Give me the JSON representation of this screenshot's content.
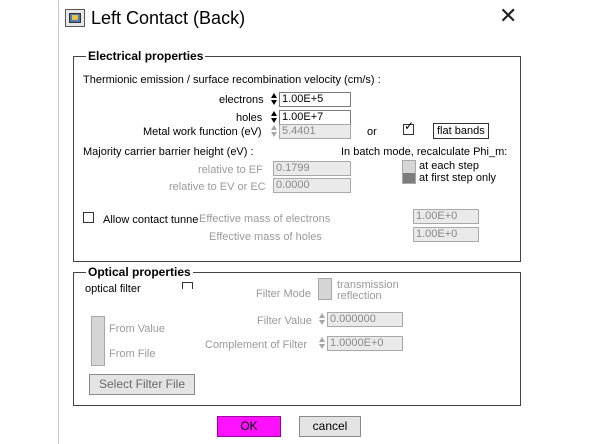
{
  "window": {
    "title": "Left Contact (Back)",
    "close_glyph": "✕"
  },
  "electrical": {
    "legend": "Electrical properties",
    "thermionic_label": "Thermionic emission / surface recombination velocity (cm/s) :",
    "electrons_label": "electrons",
    "electrons_value": "1.00E+5",
    "holes_label": "holes",
    "holes_value": "1.00E+7",
    "work_function_label": "Metal work function (eV)",
    "work_function_value": "5.4401",
    "or_label": "or",
    "flat_bands_checked": true,
    "flat_bands_label": "flat bands",
    "barrier_label": "Majority carrier barrier height (eV) :",
    "batch_label": "In batch mode, recalculate Phi_m:",
    "relative_ef_label": "relative to EF",
    "relative_ef_value": "0.1799",
    "relative_ev_label": "relative to EV or EC",
    "relative_ev_value": "0.0000",
    "batch_option_1": "at each step",
    "batch_option_2": "at first step only",
    "tunnel_label": "Allow contact tunne",
    "tunnel_checked": false,
    "mass_electrons_label": "Effective mass of electrons",
    "mass_electrons_value": "1.00E+0",
    "mass_holes_label": "Effective mass of holes",
    "mass_holes_value": "1.00E+0"
  },
  "optical": {
    "legend": "Optical properties",
    "filter_label": "optical filter",
    "filter_checked": false,
    "filter_mode_label": "Filter Mode",
    "mode_transmission": "transmission",
    "mode_reflection": "reflection",
    "from_value_label": "From Value",
    "from_file_label": "From File",
    "filter_value_label": "Filter Value",
    "filter_value": "0.000000",
    "complement_label": "Complement of Filter",
    "complement_value": "1.0000E+0",
    "select_file_label": "Select Filter File"
  },
  "buttons": {
    "ok_label": "OK",
    "cancel_label": "cancel"
  },
  "colors": {
    "ok_button": "#ff10ff",
    "disabled_text": "#9a9a9a"
  },
  "icons": {
    "app": "app-window-icon",
    "close": "close-icon",
    "check": "check-icon",
    "spin": "spin-arrows-icon"
  }
}
